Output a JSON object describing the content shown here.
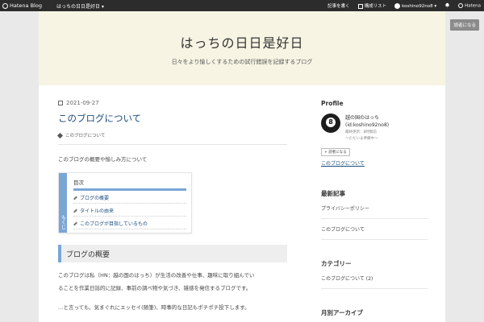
{
  "topbar": {
    "logo": "Hatena Blog",
    "blog_menu": "はっちの日日是好日 ▾",
    "write": "記事を書く",
    "manage": "構成リスト",
    "user": "koshino92no8 ▾",
    "bell": "",
    "hatena": "Hatena"
  },
  "reader_button": "読者になる",
  "header": {
    "title": "はっちの日日是好日",
    "description": "日々をより愉しくするための試行錯誤を記録するブログ"
  },
  "article": {
    "date": "2021-09-27",
    "title": "このブログについて",
    "category": "このブログについて",
    "intro": "このブログの概要や愉しみ方について",
    "toc": {
      "side_label": "もくじ",
      "heading": "目次",
      "items": [
        "ブログの概要",
        "タイトルの由来",
        "このブログが目指しているもの"
      ]
    },
    "section_heading": "ブログの概要",
    "para1_line1": "このブログは私（HN：越の国のはっち）が生活の改善や仕事、趣味に取り組んでい",
    "para1_line2": "ることを作業日誌的に記録、事前の調べ物や気づき、雑感を発信するブログです。",
    "para2": "…と言っても、気まぐれにエッセイ(随筆)、時事的な日記もポチポチ投下します。"
  },
  "sidebar": {
    "profile_heading": "Profile",
    "profile_name": "越の国のはっち",
    "profile_id": "(id:koshino92no8)",
    "profile_updated": "最終更新：8時間前",
    "profile_readers": "～ただいま準備中～",
    "reader_small": "+ 読者になる",
    "about_link": "このブログについて",
    "recent_heading": "最新記事",
    "recent_items": [
      "プライバシーポリシー",
      "このブログについて"
    ],
    "category_heading": "カテゴリー",
    "category_items": [
      "このブログについて (2)"
    ],
    "archive_heading": "月別アーカイブ"
  }
}
